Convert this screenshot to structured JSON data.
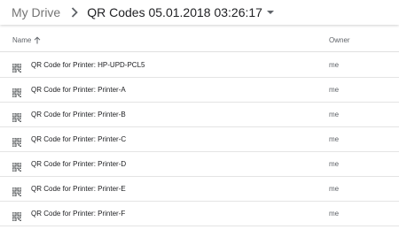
{
  "breadcrumb": {
    "root": "My Drive",
    "current": "QR Codes 05.01.2018 03:26:17"
  },
  "columns": {
    "name": "Name",
    "owner": "Owner"
  },
  "files": [
    {
      "name": "QR Code for Printer: HP-UPD-PCL5",
      "owner": "me"
    },
    {
      "name": "QR Code for Printer: Printer-A",
      "owner": "me"
    },
    {
      "name": "QR Code for Printer: Printer-B",
      "owner": "me"
    },
    {
      "name": "QR Code for Printer: Printer-C",
      "owner": "me"
    },
    {
      "name": "QR Code for Printer: Printer-D",
      "owner": "me"
    },
    {
      "name": "QR Code for Printer: Printer-E",
      "owner": "me"
    },
    {
      "name": "QR Code for Printer: Printer-F",
      "owner": "me"
    }
  ],
  "icons": {
    "separator": "chevron-right-icon",
    "dropdown": "caret-down-icon",
    "sort": "arrow-up-icon",
    "file": "qr-code-icon"
  }
}
